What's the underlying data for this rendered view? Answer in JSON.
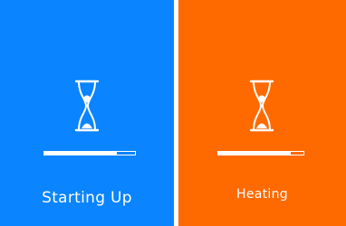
{
  "panels": [
    {
      "status": "Starting Up",
      "background": "#0a84ff",
      "progress": 0.8,
      "icon": "hourglass-icon"
    },
    {
      "status": "Heating",
      "background": "#ff6a00",
      "progress": 0.85,
      "icon": "hourglass-icon"
    }
  ]
}
